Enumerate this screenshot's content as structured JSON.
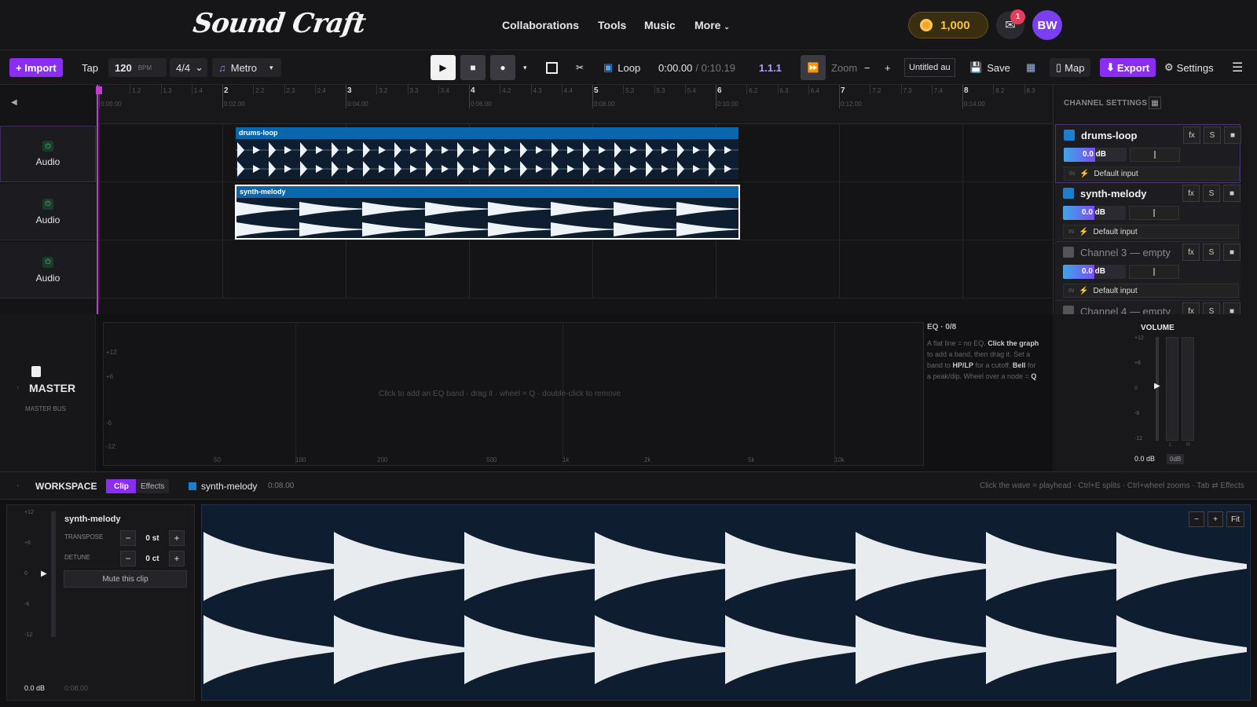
{
  "nav": {
    "logo": "Sound Craft",
    "links": [
      "Collaborations",
      "Tools",
      "Music",
      "More"
    ],
    "coins": "1,000",
    "mail_badge": "1",
    "avatar": "BW"
  },
  "toolbar": {
    "import": "+ Import",
    "tap": "Tap",
    "bpm": "120",
    "bpm_unit": "BPM",
    "meter": "4/4",
    "metro": "Metro",
    "loop": "Loop",
    "time_current": "0:00.00",
    "time_total": "/ 0:10.19",
    "position": "1.1.1",
    "zoom": "Zoom",
    "zoom_minus": "−",
    "zoom_plus": "+",
    "project_name": "Untitled au",
    "save": "Save",
    "map": "Map",
    "export": "Export",
    "settings": "Settings"
  },
  "ruler": {
    "bars": [
      "2",
      "3",
      "4",
      "5",
      "6",
      "7",
      "8"
    ],
    "subs": [
      "1.2",
      "1.3",
      "1.4",
      "2.2",
      "2.3",
      "2.4",
      "3.2",
      "3.3",
      "3.4",
      "4.2",
      "4.3",
      "4.4",
      "5.2",
      "5.3",
      "5.4",
      "6.2",
      "6.3",
      "6.4",
      "7.2",
      "7.3",
      "7.4",
      "8.2",
      "8.3"
    ],
    "times": [
      "0:00.00",
      "0:02.00",
      "0:04.00",
      "0:06.00",
      "0:08.00",
      "0:10.00",
      "0:12.00",
      "0:14.00"
    ]
  },
  "tracks": [
    {
      "label": "Audio"
    },
    {
      "label": "Audio"
    },
    {
      "label": "Audio"
    }
  ],
  "clips": [
    {
      "name": "drums-loop",
      "color": "#0a66ad"
    },
    {
      "name": "synth-melody",
      "color": "#0a66ad"
    }
  ],
  "channel_settings": {
    "title": "CHANNEL SETTINGS",
    "channels": [
      {
        "name": "drums-loop",
        "color": "#1c7fd0",
        "vol": "0.0 dB",
        "input": "Default input",
        "fx": "fx",
        "solo": "S"
      },
      {
        "name": "synth-melody",
        "color": "#1c7fd0",
        "vol": "0.0 dB",
        "input": "Default input",
        "fx": "fx",
        "solo": "S"
      },
      {
        "name": "Channel 3 — empty",
        "color": "#555",
        "vol": "0.0 dB",
        "input": "Default input",
        "fx": "fx",
        "solo": "S"
      },
      {
        "name": "Channel 4 — empty",
        "color": "#555",
        "vol": "",
        "input": "",
        "fx": "fx",
        "solo": "S"
      }
    ],
    "in_label": "IN"
  },
  "master": {
    "title": "MASTER",
    "subtitle": "MASTER BUS"
  },
  "eq": {
    "db_labels": [
      "+12",
      "+6",
      "-6",
      "-12"
    ],
    "freq_labels": [
      "50",
      "100",
      "200",
      "500",
      "1k",
      "2k",
      "5k",
      "10k"
    ],
    "hint": "Click to add an EQ band · drag it · wheel = Q · double-click to remove",
    "title": "EQ · 0/8",
    "info": [
      {
        "t": "A flat line = no EQ. ",
        "b": false
      },
      {
        "t": "Click the graph",
        "b": true
      },
      {
        "t": " to add a band, then drag it. Set a band to ",
        "b": false
      },
      {
        "t": "HP/LP",
        "b": true
      },
      {
        "t": " for a cutoff, ",
        "b": false
      },
      {
        "t": "Bell",
        "b": true
      },
      {
        "t": " for a peak/dip. Wheel over a node = ",
        "b": false
      },
      {
        "t": "Q",
        "b": true
      }
    ]
  },
  "volume": {
    "title": "VOLUME",
    "scale": [
      "+12",
      "+6",
      "0",
      "-6",
      "-12"
    ],
    "value": "0.0 dB",
    "btn": "0dB",
    "lr": [
      "L",
      "R"
    ]
  },
  "workspace": {
    "title": "WORKSPACE",
    "tabs": [
      "Clip",
      "Effects"
    ],
    "clip_name": "synth-melody",
    "clip_len": "0:08.00",
    "hint": "Click the wave = playhead · Ctrl+E splits · Ctrl+wheel zooms · Tab ⇄ Effects"
  },
  "clip_panel": {
    "name": "synth-melody",
    "transpose_label": "TRANSPOSE",
    "transpose": "0 st",
    "detune_label": "DETUNE",
    "detune": "0 ct",
    "mute": "Mute this clip",
    "db_scale": [
      "+12",
      "+6",
      "0",
      "-6",
      "-12"
    ],
    "vol": "0.0 dB",
    "len": "0:08.00"
  },
  "wave_controls": {
    "minus": "−",
    "plus": "+",
    "fit": "Fit"
  }
}
